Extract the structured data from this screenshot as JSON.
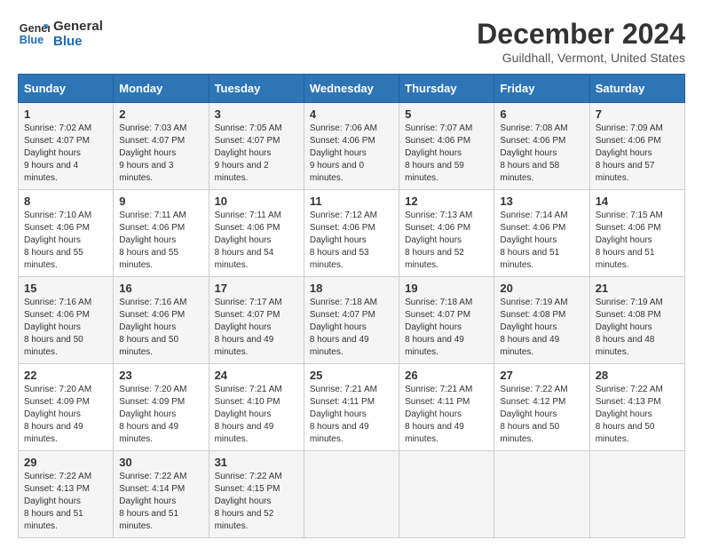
{
  "logo": {
    "line1": "General",
    "line2": "Blue"
  },
  "title": "December 2024",
  "location": "Guildhall, Vermont, United States",
  "days_of_week": [
    "Sunday",
    "Monday",
    "Tuesday",
    "Wednesday",
    "Thursday",
    "Friday",
    "Saturday"
  ],
  "weeks": [
    [
      {
        "day": "1",
        "sunrise": "7:02 AM",
        "sunset": "4:07 PM",
        "daylight": "9 hours and 4 minutes."
      },
      {
        "day": "2",
        "sunrise": "7:03 AM",
        "sunset": "4:07 PM",
        "daylight": "9 hours and 3 minutes."
      },
      {
        "day": "3",
        "sunrise": "7:05 AM",
        "sunset": "4:07 PM",
        "daylight": "9 hours and 2 minutes."
      },
      {
        "day": "4",
        "sunrise": "7:06 AM",
        "sunset": "4:06 PM",
        "daylight": "9 hours and 0 minutes."
      },
      {
        "day": "5",
        "sunrise": "7:07 AM",
        "sunset": "4:06 PM",
        "daylight": "8 hours and 59 minutes."
      },
      {
        "day": "6",
        "sunrise": "7:08 AM",
        "sunset": "4:06 PM",
        "daylight": "8 hours and 58 minutes."
      },
      {
        "day": "7",
        "sunrise": "7:09 AM",
        "sunset": "4:06 PM",
        "daylight": "8 hours and 57 minutes."
      }
    ],
    [
      {
        "day": "8",
        "sunrise": "7:10 AM",
        "sunset": "4:06 PM",
        "daylight": "8 hours and 55 minutes."
      },
      {
        "day": "9",
        "sunrise": "7:11 AM",
        "sunset": "4:06 PM",
        "daylight": "8 hours and 55 minutes."
      },
      {
        "day": "10",
        "sunrise": "7:11 AM",
        "sunset": "4:06 PM",
        "daylight": "8 hours and 54 minutes."
      },
      {
        "day": "11",
        "sunrise": "7:12 AM",
        "sunset": "4:06 PM",
        "daylight": "8 hours and 53 minutes."
      },
      {
        "day": "12",
        "sunrise": "7:13 AM",
        "sunset": "4:06 PM",
        "daylight": "8 hours and 52 minutes."
      },
      {
        "day": "13",
        "sunrise": "7:14 AM",
        "sunset": "4:06 PM",
        "daylight": "8 hours and 51 minutes."
      },
      {
        "day": "14",
        "sunrise": "7:15 AM",
        "sunset": "4:06 PM",
        "daylight": "8 hours and 51 minutes."
      }
    ],
    [
      {
        "day": "15",
        "sunrise": "7:16 AM",
        "sunset": "4:06 PM",
        "daylight": "8 hours and 50 minutes."
      },
      {
        "day": "16",
        "sunrise": "7:16 AM",
        "sunset": "4:06 PM",
        "daylight": "8 hours and 50 minutes."
      },
      {
        "day": "17",
        "sunrise": "7:17 AM",
        "sunset": "4:07 PM",
        "daylight": "8 hours and 49 minutes."
      },
      {
        "day": "18",
        "sunrise": "7:18 AM",
        "sunset": "4:07 PM",
        "daylight": "8 hours and 49 minutes."
      },
      {
        "day": "19",
        "sunrise": "7:18 AM",
        "sunset": "4:07 PM",
        "daylight": "8 hours and 49 minutes."
      },
      {
        "day": "20",
        "sunrise": "7:19 AM",
        "sunset": "4:08 PM",
        "daylight": "8 hours and 49 minutes."
      },
      {
        "day": "21",
        "sunrise": "7:19 AM",
        "sunset": "4:08 PM",
        "daylight": "8 hours and 48 minutes."
      }
    ],
    [
      {
        "day": "22",
        "sunrise": "7:20 AM",
        "sunset": "4:09 PM",
        "daylight": "8 hours and 49 minutes."
      },
      {
        "day": "23",
        "sunrise": "7:20 AM",
        "sunset": "4:09 PM",
        "daylight": "8 hours and 49 minutes."
      },
      {
        "day": "24",
        "sunrise": "7:21 AM",
        "sunset": "4:10 PM",
        "daylight": "8 hours and 49 minutes."
      },
      {
        "day": "25",
        "sunrise": "7:21 AM",
        "sunset": "4:11 PM",
        "daylight": "8 hours and 49 minutes."
      },
      {
        "day": "26",
        "sunrise": "7:21 AM",
        "sunset": "4:11 PM",
        "daylight": "8 hours and 49 minutes."
      },
      {
        "day": "27",
        "sunrise": "7:22 AM",
        "sunset": "4:12 PM",
        "daylight": "8 hours and 50 minutes."
      },
      {
        "day": "28",
        "sunrise": "7:22 AM",
        "sunset": "4:13 PM",
        "daylight": "8 hours and 50 minutes."
      }
    ],
    [
      {
        "day": "29",
        "sunrise": "7:22 AM",
        "sunset": "4:13 PM",
        "daylight": "8 hours and 51 minutes."
      },
      {
        "day": "30",
        "sunrise": "7:22 AM",
        "sunset": "4:14 PM",
        "daylight": "8 hours and 51 minutes."
      },
      {
        "day": "31",
        "sunrise": "7:22 AM",
        "sunset": "4:15 PM",
        "daylight": "8 hours and 52 minutes."
      },
      null,
      null,
      null,
      null
    ]
  ],
  "labels": {
    "sunrise": "Sunrise:",
    "sunset": "Sunset:",
    "daylight": "Daylight hours"
  }
}
